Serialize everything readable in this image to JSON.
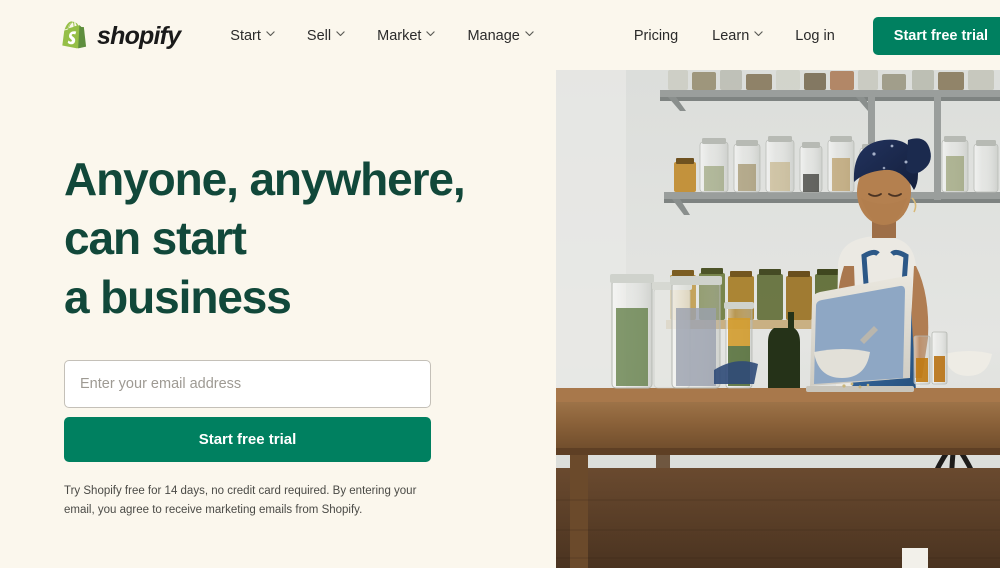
{
  "brand": {
    "name": "shopify",
    "logo_icon": "shopify-bag-icon",
    "logo_color": "#95bf47",
    "wordmark_color": "#1a1a1a"
  },
  "nav": {
    "menu_items": [
      {
        "label": "Start",
        "has_dropdown": true,
        "icon": "chevron-down-icon"
      },
      {
        "label": "Sell",
        "has_dropdown": true,
        "icon": "chevron-down-icon"
      },
      {
        "label": "Market",
        "has_dropdown": true,
        "icon": "chevron-down-icon"
      },
      {
        "label": "Manage",
        "has_dropdown": true,
        "icon": "chevron-down-icon"
      }
    ],
    "secondary_items": [
      {
        "label": "Pricing",
        "has_dropdown": false
      },
      {
        "label": "Learn",
        "has_dropdown": true,
        "icon": "chevron-down-icon"
      },
      {
        "label": "Log in",
        "has_dropdown": false
      }
    ],
    "cta_label": "Start free trial",
    "cta_color": "#008060"
  },
  "hero": {
    "headline_lines": [
      "Anyone, anywhere,",
      "can start",
      "a business"
    ],
    "headline_color": "#11483a",
    "form": {
      "email_value": "",
      "email_placeholder": "Enter your email address",
      "submit_label": "Start free trial",
      "submit_color": "#008060"
    },
    "disclaimer": "Try Shopify free for 14 days, no credit card required. By entering your email, you agree to receive marketing emails from Shopify."
  },
  "image": {
    "alt": "Woman in navy head wrap and denim overalls working on a laptop at a wooden table with glass jars of herbs and spices on shelves behind her",
    "name": "hero-photo-maker-at-workbench"
  },
  "theme": {
    "background": "#fbf7ed",
    "text": "#2b2b2b",
    "muted_text": "#4a4a46"
  }
}
